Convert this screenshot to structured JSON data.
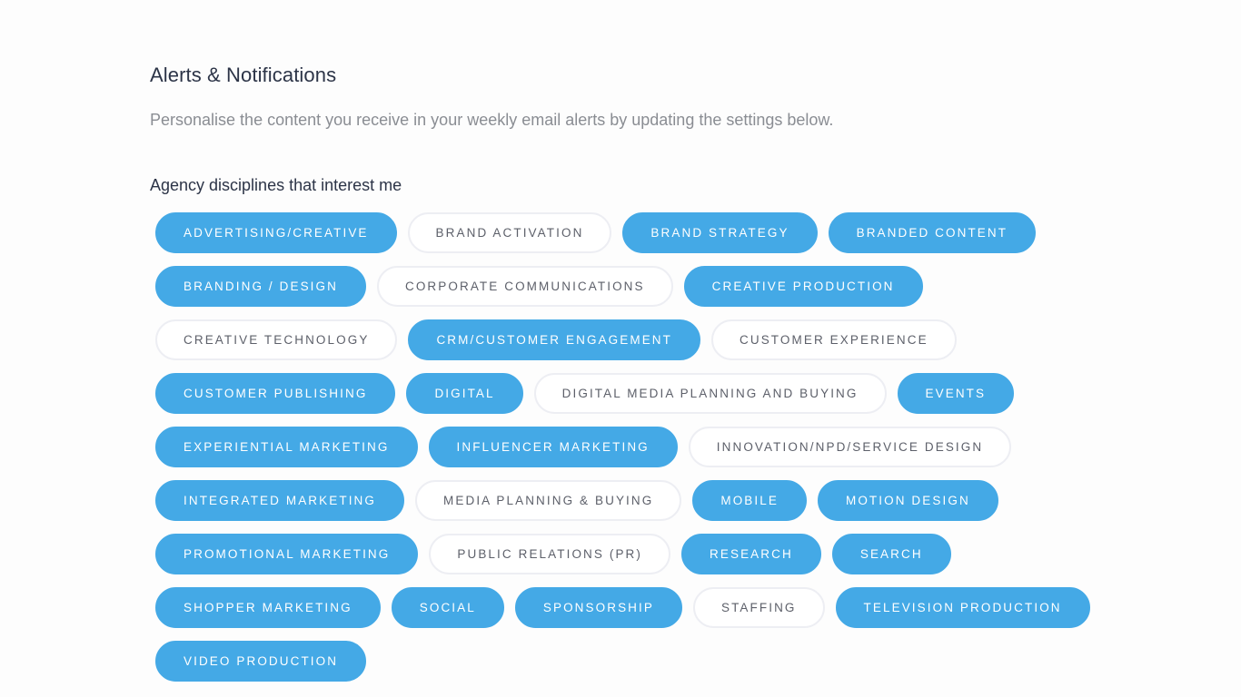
{
  "header": {
    "title": "Alerts & Notifications",
    "subtitle": "Personalise the content you receive in your weekly email alerts by updating the settings below."
  },
  "disciplines": {
    "label": "Agency disciplines that interest me",
    "colors": {
      "selected_bg": "#44a9e6",
      "selected_text": "#ffffff",
      "unselected_text": "#5d606a",
      "unselected_border": "#edeef3"
    },
    "tags": [
      {
        "label": "ADVERTISING/CREATIVE",
        "selected": true
      },
      {
        "label": "BRAND ACTIVATION",
        "selected": false
      },
      {
        "label": "BRAND STRATEGY",
        "selected": true
      },
      {
        "label": "BRANDED CONTENT",
        "selected": true
      },
      {
        "label": "BRANDING / DESIGN",
        "selected": true
      },
      {
        "label": "CORPORATE COMMUNICATIONS",
        "selected": false
      },
      {
        "label": "CREATIVE PRODUCTION",
        "selected": true
      },
      {
        "label": "CREATIVE TECHNOLOGY",
        "selected": false
      },
      {
        "label": "CRM/CUSTOMER ENGAGEMENT",
        "selected": true
      },
      {
        "label": "CUSTOMER EXPERIENCE",
        "selected": false
      },
      {
        "label": "CUSTOMER PUBLISHING",
        "selected": true
      },
      {
        "label": "DIGITAL",
        "selected": true
      },
      {
        "label": "DIGITAL MEDIA PLANNING AND BUYING",
        "selected": false
      },
      {
        "label": "EVENTS",
        "selected": true
      },
      {
        "label": "EXPERIENTIAL MARKETING",
        "selected": true
      },
      {
        "label": "INFLUENCER MARKETING",
        "selected": true
      },
      {
        "label": "INNOVATION/NPD/SERVICE DESIGN",
        "selected": false
      },
      {
        "label": "INTEGRATED MARKETING",
        "selected": true
      },
      {
        "label": "MEDIA PLANNING & BUYING",
        "selected": false
      },
      {
        "label": "MOBILE",
        "selected": true
      },
      {
        "label": "MOTION DESIGN",
        "selected": true
      },
      {
        "label": "PROMOTIONAL MARKETING",
        "selected": true
      },
      {
        "label": "PUBLIC RELATIONS (PR)",
        "selected": false
      },
      {
        "label": "RESEARCH",
        "selected": true
      },
      {
        "label": "SEARCH",
        "selected": true
      },
      {
        "label": "SHOPPER MARKETING",
        "selected": true
      },
      {
        "label": "SOCIAL",
        "selected": true
      },
      {
        "label": "SPONSORSHIP",
        "selected": true
      },
      {
        "label": "STAFFING",
        "selected": false
      },
      {
        "label": "TELEVISION PRODUCTION",
        "selected": true
      },
      {
        "label": "VIDEO PRODUCTION",
        "selected": true
      }
    ]
  }
}
